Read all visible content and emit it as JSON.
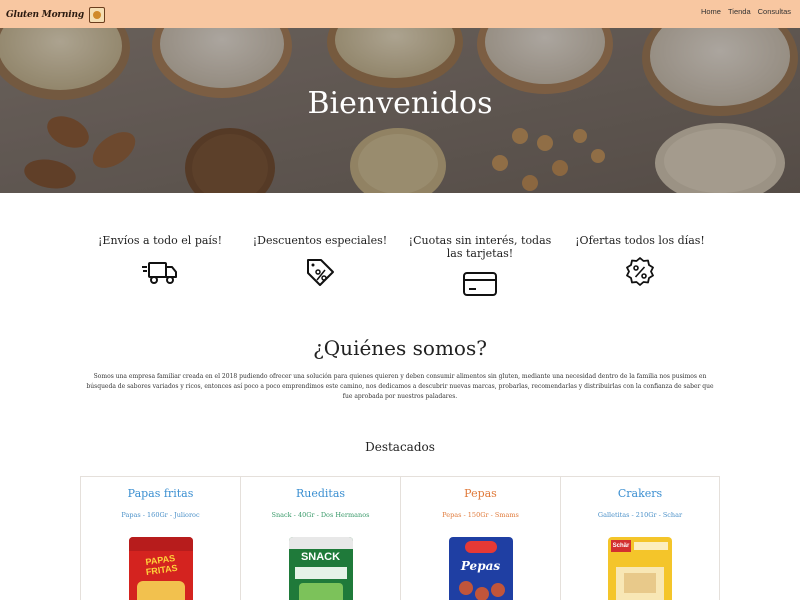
{
  "colors": {
    "navbar": "#f8c7a1",
    "card_title_blue": "#3b8fd1",
    "card_title_orange": "#e07a3a",
    "card_sub_blue": "#4a90c8",
    "card_sub_green": "#3a9a6a"
  },
  "header": {
    "brand_name": "Gluten Morning",
    "brand_logo_icon": "brand-logo-icon",
    "nav": [
      "Home",
      "Tienda",
      "Consultas"
    ]
  },
  "hero": {
    "title": "Bienvenidos"
  },
  "features": [
    {
      "text": "¡Envíos a todo el país!",
      "icon": "truck-icon"
    },
    {
      "text": "¡Descuentos especiales!",
      "icon": "tag-percent-icon"
    },
    {
      "text": "¡Cuotas sin interés, todas las tarjetas!",
      "icon": "credit-card-icon"
    },
    {
      "text": "¡Ofertas todos los días!",
      "icon": "badge-percent-icon"
    }
  ],
  "about": {
    "title": "¿Quiénes somos?",
    "text": "Somos una empresa familiar creada en el 2018 pudiendo ofrecer una solución para quienes quieren y deben consumir alimentos sin gluten, mediante una necesidad dentro de la familia nos pusimos en búsqueda de sabores variados y ricos, entonces así poco a poco emprendimos este camino, nos dedicamos a descubrir nuevas marcas, probarlas, recomendarlas y distribuirlas con la confianza de saber que fue aprobada por nuestros paladares."
  },
  "featured": {
    "title": "Destacados",
    "products": [
      {
        "name": "Papas fritas",
        "subtitle": "Papas - 160Gr - Julioroc"
      },
      {
        "name": "Rueditas",
        "subtitle": "Snack - 40Gr - Dos Hermanos"
      },
      {
        "name": "Pepas",
        "subtitle": "Pepas - 150Gr - Smams"
      },
      {
        "name": "Crakers",
        "subtitle": "Galletitas - 210Gr - Schar"
      }
    ]
  },
  "product_images": [
    {
      "label": "PAPAS FRITAS"
    },
    {
      "label": "SNACK"
    },
    {
      "label": "Pepas"
    },
    {
      "label": "Schär"
    }
  ]
}
